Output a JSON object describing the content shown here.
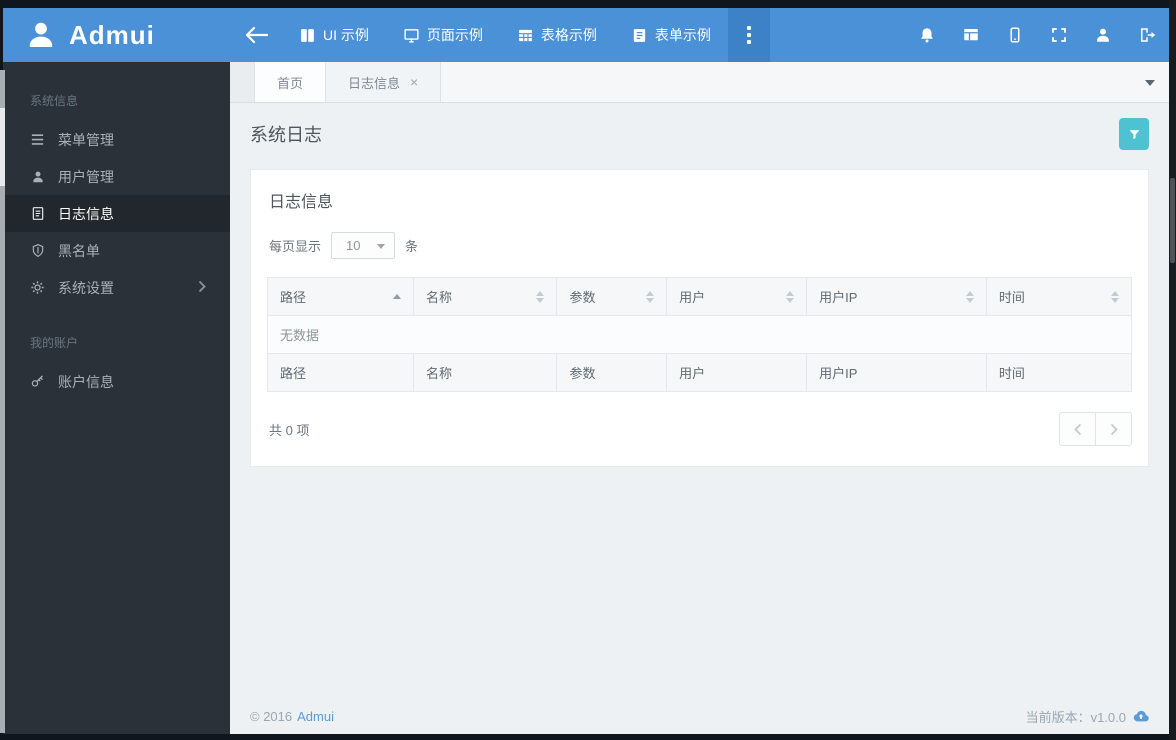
{
  "header": {
    "brand": "Admui",
    "nav_items": [
      {
        "icon": "book-icon",
        "label": "UI 示例"
      },
      {
        "icon": "monitor-icon",
        "label": "页面示例"
      },
      {
        "icon": "grid-icon",
        "label": "表格示例"
      },
      {
        "icon": "form-icon",
        "label": "表单示例"
      }
    ]
  },
  "sidebar": {
    "section1_heading": "系统信息",
    "items": [
      {
        "icon": "menu-icon",
        "label": "菜单管理"
      },
      {
        "icon": "user-icon",
        "label": "用户管理"
      },
      {
        "icon": "file-icon",
        "label": "日志信息",
        "active": true
      },
      {
        "icon": "shield-icon",
        "label": "黑名单"
      },
      {
        "icon": "gear-icon",
        "label": "系统设置",
        "has_children": true
      }
    ],
    "section2_heading": "我的账户",
    "account_item": {
      "icon": "key-icon",
      "label": "账户信息"
    }
  },
  "tabs": [
    {
      "label": "首页"
    },
    {
      "label": "日志信息",
      "closable": true,
      "active": true
    }
  ],
  "page": {
    "title": "系统日志"
  },
  "card": {
    "title": "日志信息",
    "per_page_prefix": "每页显示",
    "per_page_value": "10",
    "per_page_suffix": "条",
    "columns": [
      {
        "label": "路径",
        "sort": "asc"
      },
      {
        "label": "名称",
        "sort": "both"
      },
      {
        "label": "参数",
        "sort": "both"
      },
      {
        "label": "用户",
        "sort": "both"
      },
      {
        "label": "用户IP",
        "sort": "both"
      },
      {
        "label": "时间",
        "sort": "both"
      }
    ],
    "empty_text": "无数据",
    "rows": [],
    "total_label": "共 0 项"
  },
  "footer": {
    "copyright": "© 2016",
    "brand_link": "Admui",
    "version_label": "当前版本：v1.0.0"
  },
  "colors": {
    "header_blue": "#4a91d8",
    "header_dark_blue": "#3d82c6",
    "sidebar_dark": "#2b3138",
    "accent_teal": "#4ec2d1",
    "link_blue": "#5b9bd8"
  }
}
